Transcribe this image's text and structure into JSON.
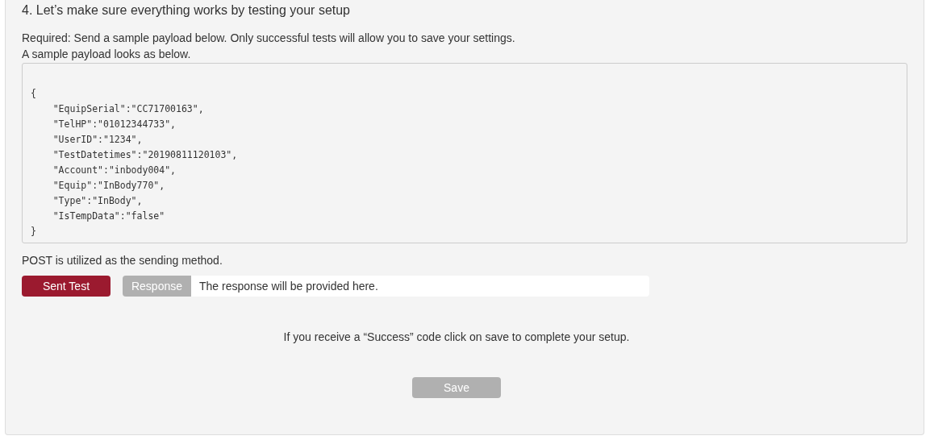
{
  "section": {
    "title": "4. Let’s make sure everything works by testing your setup",
    "instructions": [
      "Required: Send a sample payload below. Only successful tests will allow you to save your settings.",
      "A sample payload looks as below."
    ],
    "payload_lines": [
      "{",
      "    \"EquipSerial\":\"CC71700163\",",
      "    \"TelHP\":\"01012344733\",",
      "    \"UserID\":\"1234\",",
      "    \"TestDatetimes\":\"20190811120103\",",
      "    \"Account\":\"inbody004\",",
      "    \"Equip\":\"InBody770\",",
      "    \"Type\":\"InBody\",",
      "    \"IsTempData\":\"false\"",
      "}"
    ],
    "method_note": "POST is utilized as the sending method.",
    "test_button": {
      "label": "Sent Test",
      "disabled": false
    },
    "response": {
      "label": "Response",
      "placeholder": "The response will be provided here."
    },
    "success_note": "If you receive a “Success” code click on save to complete your setup.",
    "save_button": {
      "label": "Save",
      "disabled": true
    }
  }
}
